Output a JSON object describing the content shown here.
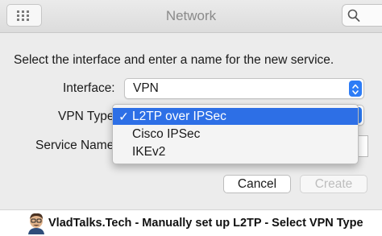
{
  "window": {
    "title": "Network"
  },
  "search": {
    "icon": "magnifier-icon"
  },
  "dialog": {
    "instruction": "Select the interface and enter a name for the new service.",
    "interface_label": "Interface:",
    "interface_value": "VPN",
    "vpn_type_label": "VPN Type",
    "service_name_label": "Service Name",
    "service_name_value": "",
    "vpn_type_menu": {
      "items": [
        {
          "label": "L2TP over IPSec",
          "selected": true
        },
        {
          "label": "Cisco IPSec",
          "selected": false
        },
        {
          "label": "IKEv2",
          "selected": false
        }
      ],
      "check_glyph": "✓"
    },
    "cancel_label": "Cancel",
    "create_label": "Create"
  },
  "caption": {
    "text": "VladTalks.Tech - Manually set up L2TP - Select VPN Type"
  },
  "colors": {
    "accent": "#2d7cf6",
    "selection": "#2d6fe6",
    "disabled_text": "#bdbdbd"
  }
}
